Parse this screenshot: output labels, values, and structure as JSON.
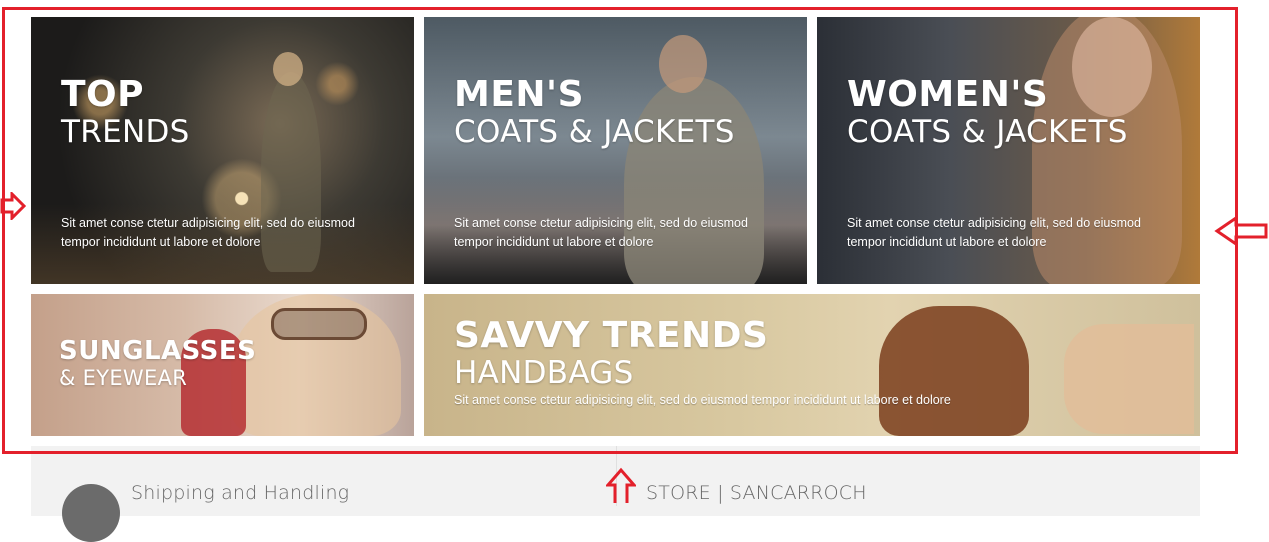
{
  "banners": [
    {
      "id": "top-trends",
      "title_bold": "TOP",
      "title_light": "TRENDS",
      "description": "Sit amet conse ctetur adipisicing elit, sed do eiusmod tempor incididunt ut labore et dolore"
    },
    {
      "id": "mens-coats",
      "title_bold": "MEN'S",
      "title_light": "COATS & JACKETS",
      "description": "Sit amet conse ctetur adipisicing elit, sed do eiusmod tempor incididunt ut labore et dolore"
    },
    {
      "id": "womens-coats",
      "title_bold": "WOMEN'S",
      "title_light": "COATS & JACKETS",
      "description": "Sit amet conse ctetur adipisicing elit, sed do eiusmod tempor incididunt ut labore et dolore"
    },
    {
      "id": "sunglasses",
      "title_bold": "SUNGLASSES",
      "title_light": "& EYEWEAR"
    },
    {
      "id": "handbags",
      "title_bold": "SAVVY TRENDS",
      "title_light": "HANDBAGS",
      "description": "Sit amet conse ctetur adipisicing elit, sed do eiusmod tempor incididunt ut labore et dolore"
    }
  ],
  "info": {
    "shipping_title": "Shipping and Handling",
    "store_title": "STORE | SANCARROCH"
  },
  "colors": {
    "annotation": "#e3202b",
    "text": "#ffffff"
  },
  "icons": {
    "left_arrow": "arrow-right-icon",
    "right_arrow": "arrow-left-icon",
    "bottom_arrow": "arrow-up-icon",
    "shipping": "circle-icon"
  }
}
